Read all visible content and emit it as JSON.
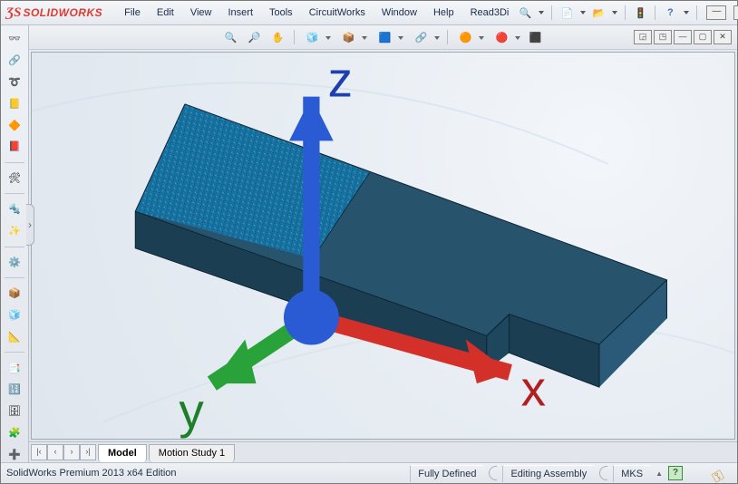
{
  "logo": {
    "ds": "ƷS",
    "name": "SOLIDWORKS"
  },
  "menu": [
    "File",
    "Edit",
    "View",
    "Insert",
    "Tools",
    "CircuitWorks",
    "Window",
    "Help",
    "Read3Di"
  ],
  "menu_icons": {
    "search": "🔍",
    "new": "📄",
    "open": "📂",
    "traffic": "🚦",
    "help": "?"
  },
  "left_tools": [
    {
      "g": "👓",
      "name": "glasses-icon"
    },
    {
      "g": "🔗",
      "name": "link-icon"
    },
    {
      "g": "➰",
      "name": "sketch-tool-icon"
    },
    {
      "g": "📒",
      "name": "notebook-icon"
    },
    {
      "g": "🔶",
      "name": "feature-icon"
    },
    {
      "g": "📕",
      "name": "sheet-icon"
    },
    {
      "sep": true
    },
    {
      "g": "🛠",
      "name": "wrench-icon"
    },
    {
      "sep": true
    },
    {
      "g": "🔩",
      "name": "fastener-icon"
    },
    {
      "g": "✨",
      "name": "spark-icon"
    },
    {
      "sep": true
    },
    {
      "g": "⚙️",
      "name": "gear-icon"
    },
    {
      "sep": true
    },
    {
      "g": "📦",
      "name": "box-icon"
    },
    {
      "g": "🧊",
      "name": "solid-icon"
    },
    {
      "g": "📐",
      "name": "measure-icon"
    },
    {
      "sep": true
    },
    {
      "g": "📑",
      "name": "align-left-icon"
    },
    {
      "g": "🔢",
      "name": "numbers-icon"
    },
    {
      "g": "🗄",
      "name": "cabinet-icon"
    },
    {
      "g": "🧩",
      "name": "puzzle-icon"
    },
    {
      "g": "➕",
      "name": "plus-icon"
    }
  ],
  "view_tools": [
    {
      "g": "🔍",
      "drop": false,
      "name": "zoom-fit-icon"
    },
    {
      "g": "🔎",
      "drop": false,
      "name": "zoom-area-icon"
    },
    {
      "g": "✋",
      "drop": false,
      "name": "pan-icon"
    },
    {
      "g": "🧊",
      "drop": true,
      "name": "orientation-icon"
    },
    {
      "g": "📦",
      "drop": true,
      "name": "display-style-icon"
    },
    {
      "g": "🟦",
      "drop": true,
      "name": "section-icon"
    },
    {
      "g": "🔗",
      "drop": true,
      "name": "chain-icon"
    },
    {
      "g": "🟠",
      "drop": true,
      "name": "appearance-sphere-icon"
    },
    {
      "g": "🔴",
      "drop": true,
      "name": "scene-sphere-icon"
    },
    {
      "g": "⬛",
      "drop": false,
      "name": "image-capture-icon"
    }
  ],
  "tabs": {
    "items": [
      "Model",
      "Motion Study 1"
    ],
    "active": 0
  },
  "triad_labels": {
    "x": "x",
    "y": "y",
    "z": "z"
  },
  "status": {
    "edition": "SolidWorks Premium 2013 x64 Edition",
    "state": "Fully Defined",
    "mode": "Editing Assembly",
    "units": "MKS",
    "tri": "▲"
  }
}
